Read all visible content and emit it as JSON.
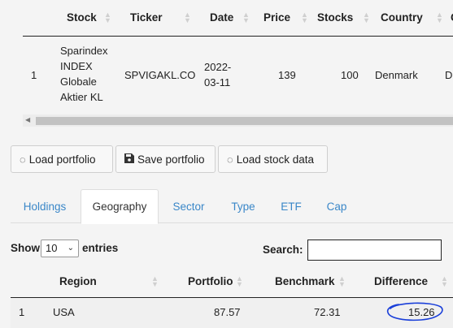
{
  "top_table": {
    "headers": [
      "Stock",
      "Ticker",
      "Date",
      "Price",
      "Stocks",
      "Country",
      "C"
    ],
    "row": {
      "index": "1",
      "stock_lines": [
        "Sparindex",
        "INDEX",
        "Globale",
        "Aktier KL"
      ],
      "ticker": "SPVIGAKL.CO",
      "date_lines": [
        "2022-",
        "03-11"
      ],
      "price": "139",
      "stocks": "100",
      "country": "Denmark",
      "overflow": "D"
    }
  },
  "buttons": {
    "load_portfolio": "Load portfolio",
    "save_portfolio": "Save portfolio",
    "load_stock_data": "Load stock data"
  },
  "tabs": [
    "Holdings",
    "Geography",
    "Sector",
    "Type",
    "ETF",
    "Cap"
  ],
  "active_tab": "Geography",
  "controls": {
    "show_label": "Show",
    "entries_value": "10",
    "entries_label": "entries",
    "search_label": "Search:",
    "search_value": ""
  },
  "geo_table": {
    "headers": [
      "Region",
      "Portfolio",
      "Benchmark",
      "Difference"
    ],
    "rows": [
      {
        "index": "1",
        "region": "USA",
        "portfolio": "87.57",
        "benchmark": "72.31",
        "difference": "15.26"
      }
    ]
  },
  "colors": {
    "accent_link": "#3a87c8",
    "annotation_circle": "#1a3fd9"
  }
}
